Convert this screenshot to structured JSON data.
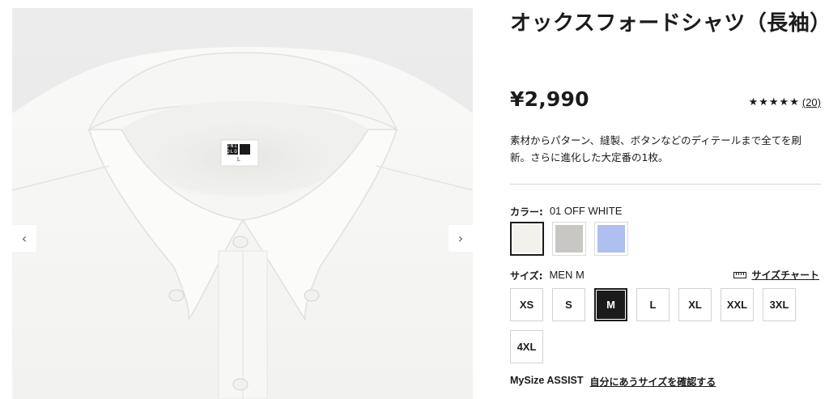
{
  "product": {
    "title": "オックスフォードシャツ（長袖）",
    "price": "¥2,990",
    "stars": "★★★★★",
    "review_count": "(20)",
    "rating_value": 4.6,
    "description": "素材からパターン、縫製、ボタンなどのディテールまで全てを刷新。さらに進化した大定番の1枚。"
  },
  "gallery": {
    "prev_icon": "‹",
    "next_icon": "›",
    "tag_brand_top": "UNI",
    "tag_brand_bottom": "QLO",
    "tag_size": "L"
  },
  "color": {
    "label": "カラー:",
    "selected_value": "01 OFF WHITE",
    "swatches": [
      {
        "name": "off-white",
        "hex": "#f3f1ec",
        "selected": true
      },
      {
        "name": "gray",
        "hex": "#c9c7c4",
        "selected": false
      },
      {
        "name": "blue",
        "hex": "#aebff0",
        "selected": false
      }
    ]
  },
  "size": {
    "label": "サイズ:",
    "selected_value": "MEN M",
    "chart_link": "サイズチャート",
    "options": [
      "XS",
      "S",
      "M",
      "L",
      "XL",
      "XXL",
      "3XL",
      "4XL"
    ],
    "selected": "M"
  },
  "mysize": {
    "label": "MySize ASSIST",
    "link": "自分にあうサイズを確認する"
  }
}
